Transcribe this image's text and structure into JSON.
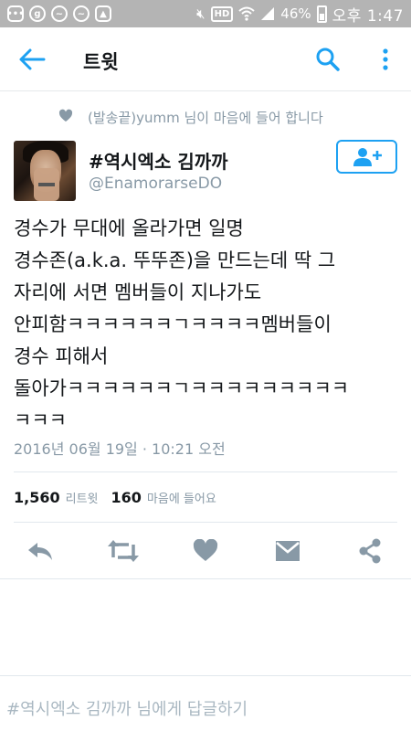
{
  "status_bar": {
    "battery": "46%",
    "time": "오후 1:47",
    "hd_label": "HD"
  },
  "app_bar": {
    "title": "트윗"
  },
  "liked_notice": {
    "text": "(발송끝)yumm 님이 마음에 들어 합니다"
  },
  "author": {
    "name": "#역시엑소 김까까",
    "handle": "@EnamorarseDO"
  },
  "tweet": {
    "text": "경수가 무대에 올라가면 일명\n경수존(a.k.a. 뚜뚜존)을 만드는데 딱 그\n자리에 서면 멤버들이 지나가도\n안피함ㅋㅋㅋㅋㅋㅋㄱㅋㅋㅋㅋ멤버들이\n경수 피해서\n돌아가ㅋㅋㅋㅋㅋㅋㄱㅋㅋㅋㅋㅋㅋㅋㅋㅋ\nㅋㅋㅋ",
    "timestamp": "2016년 06월 19일 · 10:21 오전"
  },
  "stats": {
    "retweets_count": "1,560",
    "retweets_label": "리트윗",
    "likes_count": "160",
    "likes_label": "마음에 들어요"
  },
  "reply": {
    "placeholder": "#역시엑소 김까까 님에게 답글하기"
  },
  "colors": {
    "accent": "#1da1f2",
    "icon_gray": "#8899a6",
    "status_bar": "#b4b4b4"
  },
  "icons": [
    "back-arrow-icon",
    "search-icon",
    "more-vert-icon",
    "heart-icon",
    "follow-user-icon",
    "reply-icon",
    "retweet-icon",
    "like-icon",
    "message-icon",
    "share-icon"
  ]
}
